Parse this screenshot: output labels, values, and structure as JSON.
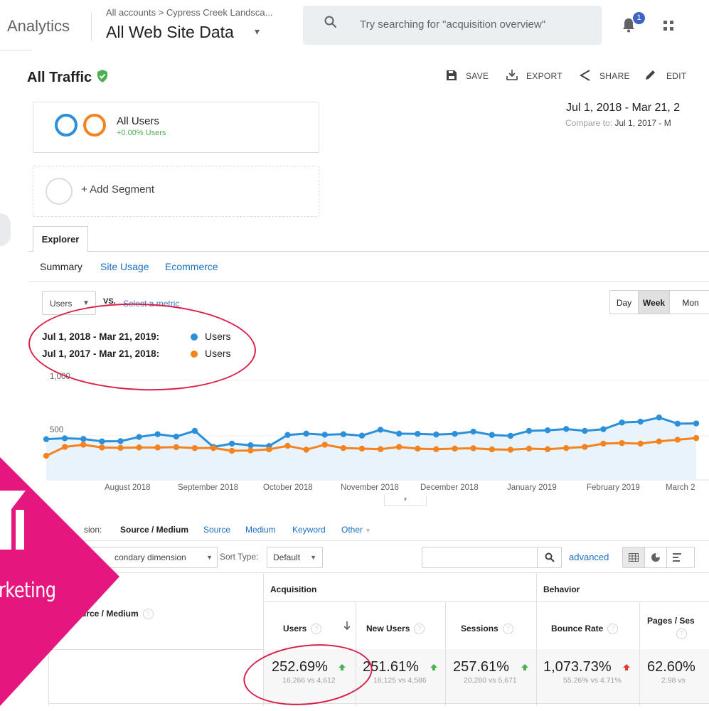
{
  "topbar": {
    "brand": "Analytics",
    "breadcrumb": "All accounts > Cypress Creek Landsca...",
    "view_name": "All Web Site Data",
    "view_caret": "▾",
    "search_placeholder": "Try searching for \"acquisition overview\"",
    "notifications_count": "1"
  },
  "report": {
    "title": "All Traffic",
    "actions": {
      "save": "SAVE",
      "export": "EXPORT",
      "share": "SHARE",
      "edit": "EDIT"
    }
  },
  "segments": {
    "active_name": "All Users",
    "active_sub": "+0.00% Users",
    "add_label": "+ Add Segment"
  },
  "date_range": {
    "primary": "Jul 1, 2018 - Mar 21, 2",
    "compare_label": "Compare to: ",
    "compare_value": "Jul 1, 2017 - M"
  },
  "explorer": {
    "tab": "Explorer",
    "subtabs": [
      "Summary",
      "Site Usage",
      "Ecommerce"
    ],
    "metric": "Users",
    "vs": "VS.",
    "select_metric": "Select a metric",
    "periods": [
      "Day",
      "Week",
      "Mon"
    ],
    "active_period": "Week"
  },
  "chart_legend": {
    "row1_range": "Jul 1, 2018 - Mar 21, 2019:",
    "row2_range": "Jul 1, 2017 - Mar 21, 2018:",
    "series_label": "Users"
  },
  "chart_data": {
    "type": "line",
    "ylabels": [
      "1,000",
      "500"
    ],
    "ylim": [
      0,
      1100
    ],
    "x_labels": [
      "August 2018",
      "September 2018",
      "October 2018",
      "November 2018",
      "December 2018",
      "January 2019",
      "February 2019",
      "March 2"
    ],
    "series": [
      {
        "values": [
          470,
          478,
          472,
          450,
          452,
          490,
          515,
          493,
          545,
          400,
          430,
          415,
          408,
          508,
          520,
          510,
          515,
          502,
          555,
          520,
          518,
          512,
          518,
          538,
          508,
          500,
          545,
          550,
          562,
          545,
          560,
          620,
          628,
          665,
          610,
          612
        ],
        "color": "#2b90d9"
      },
      {
        "values": [
          320,
          400,
          420,
          395,
          392,
          395,
          395,
          398,
          390,
          390,
          365,
          368,
          378,
          410,
          375,
          420,
          390,
          385,
          380,
          400,
          385,
          380,
          385,
          388,
          378,
          375,
          385,
          380,
          390,
          400,
          430,
          435,
          430,
          450,
          465,
          480
        ],
        "color": "#f4831f"
      }
    ]
  },
  "table": {
    "primary_dim_label": "sion:",
    "primary_dim_value": "Source / Medium",
    "dim_links": [
      "Source",
      "Medium",
      "Keyword",
      "Other"
    ],
    "secondary_dim": "condary dimension",
    "sort_type_label": "Sort Type:",
    "sort_type_value": "Default",
    "advanced": "advanced",
    "group_acquisition": "Acquisition",
    "group_behavior": "Behavior",
    "dim_col_header": "urce / Medium",
    "columns": [
      "Users",
      "New Users",
      "Sessions",
      "Bounce Rate",
      "Pages / Ses"
    ],
    "totals": [
      {
        "big": "252.69%",
        "small": "16,266 vs 4,612",
        "trend": "up-good"
      },
      {
        "big": "251.61%",
        "small": "16,125 vs 4,586",
        "trend": "up-good"
      },
      {
        "big": "257.61%",
        "small": "20,280 vs 5,671",
        "trend": "up-good"
      },
      {
        "big": "1,073.73%",
        "small": "55.26% vs 4.71%",
        "trend": "up-bad"
      },
      {
        "big": "62.60%",
        "small": "2.98 vs",
        "trend": "none"
      }
    ]
  },
  "overlay": {
    "ribbon_text": "rketing",
    "colors": {
      "ribbon": "#e5177e",
      "annotation": "#d92049"
    }
  }
}
